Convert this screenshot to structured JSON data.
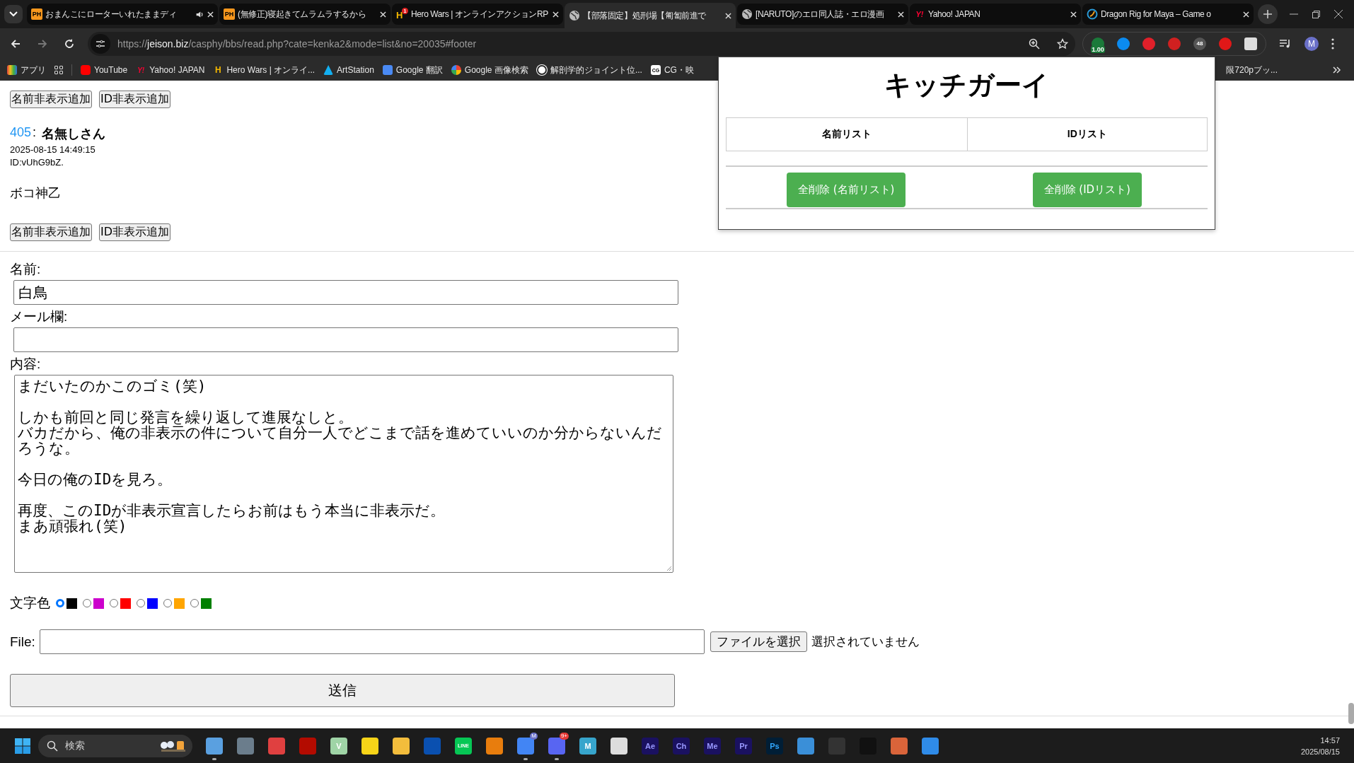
{
  "browser": {
    "tabs": [
      {
        "title": "おまんこにローターいれたままディ",
        "kind": "ph",
        "icon_text": "PH",
        "audio": true,
        "selected": false
      },
      {
        "title": "(無修正)寝起きてムラムラするから",
        "kind": "ph",
        "icon_text": "PH",
        "audio": false,
        "selected": false
      },
      {
        "title": "Hero Wars | オンラインアクションRP",
        "kind": "hero",
        "icon_text": "H",
        "icon_badge": "1",
        "audio": false,
        "selected": false
      },
      {
        "title": "【部落固定】処刑場【匍匐前進で",
        "kind": "globe",
        "audio": false,
        "selected": true
      },
      {
        "title": "[NARUTO]のエロ同人誌・エロ漫画",
        "kind": "globe",
        "audio": false,
        "selected": false
      },
      {
        "title": "Yahoo! JAPAN",
        "kind": "yahoo",
        "icon_text": "Y!",
        "audio": false,
        "selected": false
      },
      {
        "title": "Dragon Rig for Maya – Game o",
        "kind": "ring",
        "audio": false,
        "selected": false
      }
    ],
    "url": {
      "scheme": "https://",
      "host": "jeison.biz",
      "path": "/casphy/bbs/read.php?cate=kenka2&mode=list&no=20035#footer"
    },
    "extensions": [
      {
        "kind": "speed",
        "badge": "1.00"
      },
      {
        "kind": "shazam"
      },
      {
        "kind": "loop"
      },
      {
        "kind": "blocked"
      },
      {
        "kind": "counter",
        "badge": "48"
      },
      {
        "kind": "hand"
      },
      {
        "kind": "puzzle"
      }
    ],
    "profile": "M",
    "bookmarks": [
      {
        "kind": "apps",
        "label": "アプリ"
      },
      {
        "kind": "grid"
      },
      {
        "kind": "youtube",
        "label": "YouTube"
      },
      {
        "kind": "yahoo",
        "icon_text": "Y!",
        "label": "Yahoo! JAPAN"
      },
      {
        "kind": "hero",
        "icon_text": "H",
        "label": "Hero Wars | オンライ..."
      },
      {
        "kind": "artstation",
        "label": "ArtStation"
      },
      {
        "kind": "translate",
        "label": "Google 翻訳"
      },
      {
        "kind": "google",
        "label": "Google 画像検索"
      },
      {
        "kind": "wordpress",
        "label": "解剖学的ジョイント位..."
      },
      {
        "kind": "cg",
        "icon_text": "CG",
        "label": "CG・映"
      }
    ],
    "bookmark_right": "限720pブッ..."
  },
  "popup": {
    "title": "キッチガーイ",
    "columns": [
      "名前リスト",
      "IDリスト"
    ],
    "buttons": [
      "全削除 (名前リスト)",
      "全削除 (IDリスト)"
    ]
  },
  "post_buttons_top": [
    "名前非表示追加",
    "ID非表示追加"
  ],
  "post": {
    "number": "405",
    "separator": ":",
    "name": "名無しさん",
    "date": "2025-08-15 14:49:15",
    "id": "ID:vUhG9bZ.",
    "body": "ボコ神乙"
  },
  "post_buttons_bottom": [
    "名前非表示追加",
    "ID非表示追加"
  ],
  "form": {
    "name_label": "名前:",
    "name_value": "白鳥",
    "mail_label": "メール欄:",
    "content_label": "内容:",
    "content_paragraphs": [
      [
        "まだいたのかこのゴミ(笑)"
      ],
      [
        "しかも前回と同じ発言を繰り返して進展なしと。",
        "バカだから、俺の非表示の件について自分一人でどこまで話を進めていいのか分からないんだろうな。"
      ],
      [
        "今日の俺のIDを見ろ。"
      ],
      [
        "再度、このIDが非表示宣言したらお前はもう本当に非表示だ。",
        "まあ頑張れ(笑)"
      ]
    ],
    "color_label": "文字色",
    "colors": [
      {
        "color": "#000000",
        "selected": true
      },
      {
        "color": "#cc00cc",
        "selected": false
      },
      {
        "color": "#ff0000",
        "selected": false
      },
      {
        "color": "#0000ff",
        "selected": false
      },
      {
        "color": "#ffa500",
        "selected": false
      },
      {
        "color": "#008000",
        "selected": false
      }
    ],
    "file_label": "File:",
    "file_button": "ファイルを選択",
    "file_status": "選択されていません",
    "submit": "送信"
  },
  "taskbar": {
    "search_placeholder": "検索",
    "apps": [
      {
        "kind": "paint",
        "running": true
      },
      {
        "kind": "calc",
        "running": false
      },
      {
        "kind": "snip",
        "running": false
      },
      {
        "kind": "acrobat",
        "running": false
      },
      {
        "kind": "letter",
        "label": "V",
        "running": false
      },
      {
        "kind": "sticky",
        "running": false
      },
      {
        "kind": "folder",
        "running": false
      },
      {
        "kind": "playstation",
        "running": false
      },
      {
        "kind": "line",
        "label": "LINE",
        "running": false
      },
      {
        "kind": "blender",
        "running": false
      },
      {
        "kind": "chrome",
        "badge": "M",
        "running": true
      },
      {
        "kind": "discord",
        "badge": "9+",
        "running": true
      },
      {
        "kind": "maya",
        "label": "M",
        "running": false
      },
      {
        "kind": "zbrush",
        "running": false
      },
      {
        "kind": "adobe",
        "label": "Ae",
        "running": false
      },
      {
        "kind": "adobe",
        "label": "Ch",
        "running": false
      },
      {
        "kind": "adobe",
        "label": "Me",
        "running": false
      },
      {
        "kind": "adobe",
        "label": "Pr",
        "running": false
      },
      {
        "kind": "adobe-ps",
        "label": "Ps",
        "running": false
      },
      {
        "kind": "panel",
        "running": false
      },
      {
        "kind": "obs",
        "running": false
      },
      {
        "kind": "unreal",
        "running": false
      },
      {
        "kind": "speaker",
        "running": false
      },
      {
        "kind": "bluebox",
        "running": false
      }
    ],
    "time": "14:57",
    "date": "2025/08/15"
  }
}
